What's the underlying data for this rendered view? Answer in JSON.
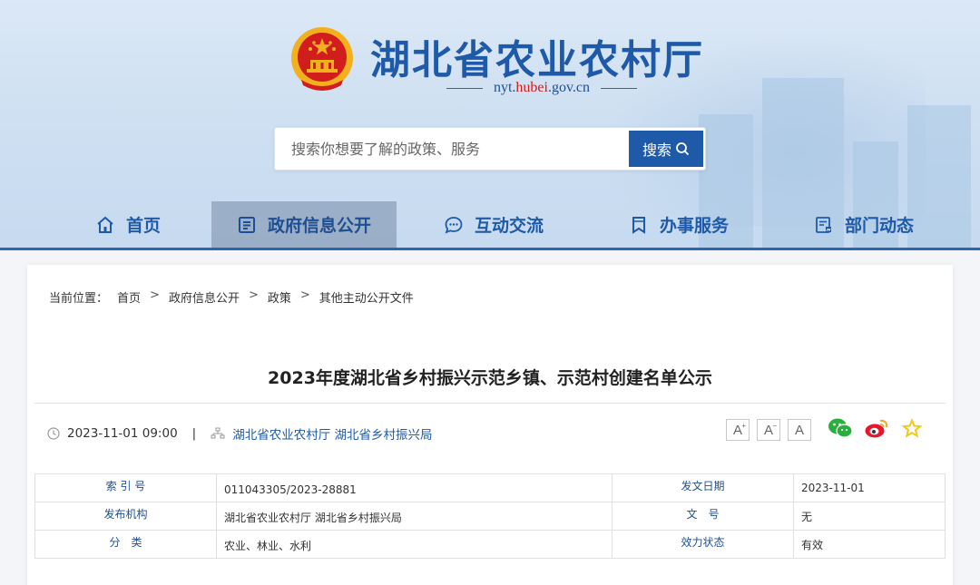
{
  "site": {
    "title": "湖北省农业农村厅",
    "url_prefix": "nyt.",
    "url_highlight": "hubei",
    "url_suffix": ".gov.cn"
  },
  "search": {
    "placeholder": "搜索你想要了解的政策、服务",
    "button_label": "搜索"
  },
  "nav": {
    "items": [
      {
        "label": "首页",
        "icon": "home-icon"
      },
      {
        "label": "政府信息公开",
        "icon": "document-icon",
        "active": true
      },
      {
        "label": "互动交流",
        "icon": "chat-icon"
      },
      {
        "label": "办事服务",
        "icon": "bookmark-icon"
      },
      {
        "label": "部门动态",
        "icon": "news-icon"
      }
    ]
  },
  "breadcrumb": {
    "prefix": "当前位置：",
    "items": [
      "首页",
      "政府信息公开",
      "政策",
      "其他主动公开文件"
    ],
    "separator": ">"
  },
  "article": {
    "title": "2023年度湖北省乡村振兴示范乡镇、示范村创建名单公示",
    "datetime": "2023-11-01 09:00",
    "divider": "|",
    "source": "湖北省农业农村厅 湖北省乡村振兴局"
  },
  "font_buttons": [
    "A",
    "A",
    "A"
  ],
  "share_icons": [
    "wechat-icon",
    "weibo-icon",
    "favorite-icon"
  ],
  "info_table": {
    "rows": [
      {
        "label1": "索 引 号",
        "value1": "011043305/2023-28881",
        "label2": "发文日期",
        "value2": "2023-11-01"
      },
      {
        "label1": "发布机构",
        "value1": "湖北省农业农村厅 湖北省乡村振兴局",
        "label2": "文　号",
        "value2": "无"
      },
      {
        "label1": "分　类",
        "value1": "农业、林业、水利",
        "label2": "效力状态",
        "value2": "有效"
      }
    ]
  },
  "colors": {
    "brand_blue": "#1f5aa8",
    "nav_active_bg": "#7a8ba6",
    "url_red": "#c81e1e",
    "emblem_red": "#d21d1d",
    "emblem_gold": "#f2b11c"
  }
}
